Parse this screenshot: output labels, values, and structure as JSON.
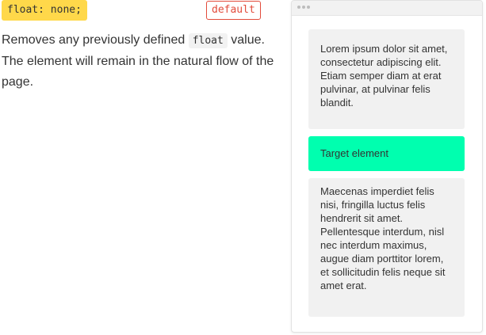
{
  "header": {
    "code_label": "float: none;",
    "badge_label": "default"
  },
  "description": {
    "before": "Removes any previously defined ",
    "code": "float",
    "after": " value. The element will remain in the natural flow of the page."
  },
  "demo": {
    "top_text": "Lorem ipsum dolor sit amet, consectetur adipiscing elit. Etiam semper diam at erat pulvinar, at pulvinar felis blandit.",
    "target_text": "Target element",
    "bottom_text": "Maecenas imperdiet felis nisi, fringilla luctus felis hendrerit sit amet. Pellentesque interdum, nisl nec interdum maximus, augue diam porttitor lorem, et sollicitudin felis neque sit amet erat."
  },
  "colors": {
    "code_chip": "#ffd84a",
    "badge": "#e24b3b",
    "target": "#00ffaf",
    "box": "#f1f1f1"
  },
  "icons": {
    "frame_dots": "window-dots-icon"
  }
}
